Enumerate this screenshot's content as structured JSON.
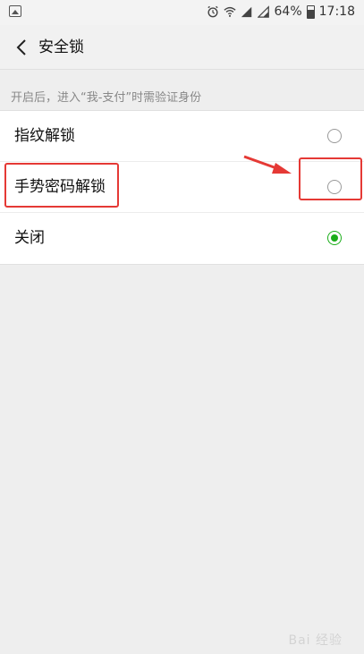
{
  "status_bar": {
    "battery": "64%",
    "time": "17:18",
    "icons": [
      "image-icon",
      "alarm-icon",
      "wifi-icon",
      "signal-icon",
      "signal-icon",
      "battery-icon"
    ]
  },
  "app_bar": {
    "title": "安全锁",
    "back_icon": "back-icon"
  },
  "hint": "开启后，进入“我-支付”时需验证身份",
  "options": [
    {
      "label": "指纹解锁",
      "selected": false
    },
    {
      "label": "手势密码解锁",
      "selected": false
    },
    {
      "label": "关闭",
      "selected": true
    }
  ],
  "colors": {
    "accent": "#1aad19",
    "annotation": "#e53935"
  },
  "watermark": "Bai 经验"
}
